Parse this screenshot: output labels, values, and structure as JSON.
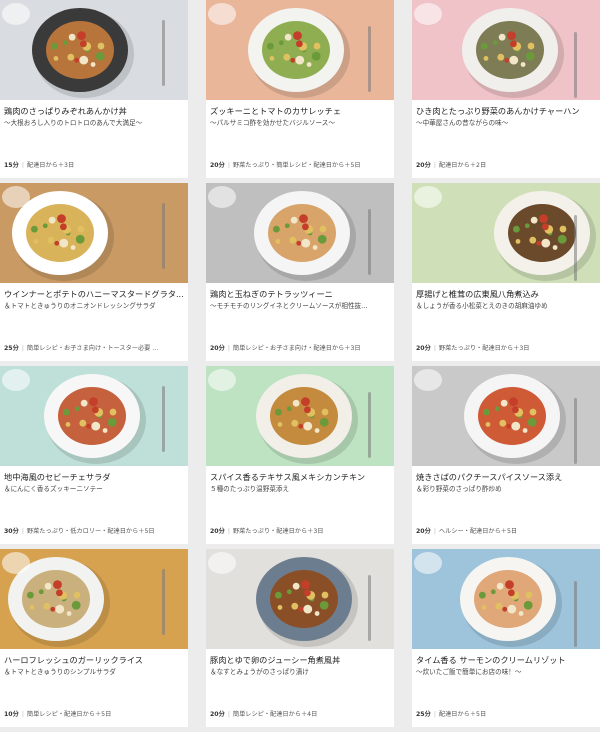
{
  "recipes": [
    {
      "title": "鶏肉のさっぱりみぞれあんかけ丼",
      "subtitle": "〜大根おろし入りのトロトロのあんで大満足〜",
      "time": "15分",
      "tags": "配達日から＋3日",
      "bg": "#d9dde2",
      "plate": "#3a3a3a",
      "food": "#b7743b"
    },
    {
      "title": "ズッキーニとトマトのカサレッチェ",
      "subtitle": "〜パルサミコ酢を効かせたバジルソース〜",
      "time": "20分",
      "tags": "野菜たっぷり・簡単レシピ・配達日から＋5日",
      "bg": "#e9b69a",
      "plate": "#f3f3f0",
      "food": "#8fae52"
    },
    {
      "title": "ひき肉とたっぷり野菜のあんかけチャーハン",
      "subtitle": "〜中華屋さんの昔ながらの味〜",
      "time": "20分",
      "tags": "配達日から＋2日",
      "bg": "#efc3c8",
      "plate": "#f0efec",
      "food": "#7e7c55"
    },
    {
      "title": "ウインナーとポテトのハニーマスタードグラタ...",
      "subtitle": "＆トマトときゅうりのオニオンドレッシングサラダ",
      "time": "25分",
      "tags": "簡単レシピ・お子さま向け・トースター必要 ...",
      "bg": "#c99a64",
      "plate": "#ffffff",
      "food": "#d8b35a"
    },
    {
      "title": "鶏肉と玉ねぎのテトラッツィーニ",
      "subtitle": "〜モチモチのリングイネとクリームソースが相性抜...",
      "time": "20分",
      "tags": "簡単レシピ・お子さま向け・配達日から＋3日",
      "bg": "#bfbfbf",
      "plate": "#f5f5f5",
      "food": "#d8a46a"
    },
    {
      "title": "厚揚げと椎茸の広東風八角煮込み",
      "subtitle": "＆しょうが香る小松菜とえのきの胡麻油ゆめ",
      "time": "20分",
      "tags": "野菜たっぷり・配達日から＋3日",
      "bg": "#cfe0b8",
      "plate": "#f4f1ea",
      "food": "#6b4a2c"
    },
    {
      "title": "地中海風のセビーチェサラダ",
      "subtitle": "＆にんにく香るズッキーニソテー",
      "time": "30分",
      "tags": "野菜たっぷり・低カロリー・配達日から＋5日",
      "bg": "#bfe0d8",
      "plate": "#f7f7f7",
      "food": "#c6613d"
    },
    {
      "title": "スパイス香るテキサス風メキシカンチキン",
      "subtitle": "５種のたっぷり温野菜添え",
      "time": "20分",
      "tags": "野菜たっぷり・配達日から＋3日",
      "bg": "#bde3c2",
      "plate": "#f1efe8",
      "food": "#c48a3d"
    },
    {
      "title": "焼きさばのパクチースパイスソース添え",
      "subtitle": "＆彩り野菜のさっぱり酢炒め",
      "time": "20分",
      "tags": "ヘルシー・配達日から＋5日",
      "bg": "#c9c9c9",
      "plate": "#f5f5f5",
      "food": "#cf5a36"
    },
    {
      "title": "ハーロフレッシュのガーリックライス",
      "subtitle": "＆トマトときゅうりのシンプルサラダ",
      "time": "10分",
      "tags": "簡単レシピ・配達日から＋5日",
      "bg": "#d6a250",
      "plate": "#f2f2f0",
      "food": "#c9b07c"
    },
    {
      "title": "豚肉とゆで卵のジューシー角煮風丼",
      "subtitle": "＆なすとみょうがのさっぱり漬け",
      "time": "20分",
      "tags": "簡単レシピ・配達日から＋4日",
      "bg": "#e2e0dc",
      "plate": "#6d7d90",
      "food": "#8a4f27"
    },
    {
      "title": "タイム香る サーモンのクリームリゾット",
      "subtitle": "〜炊いたご飯で簡単にお店の味！〜",
      "time": "25分",
      "tags": "配達日から＋5日",
      "bg": "#9ec4dc",
      "plate": "#f6f5f1",
      "food": "#e0a778"
    }
  ]
}
